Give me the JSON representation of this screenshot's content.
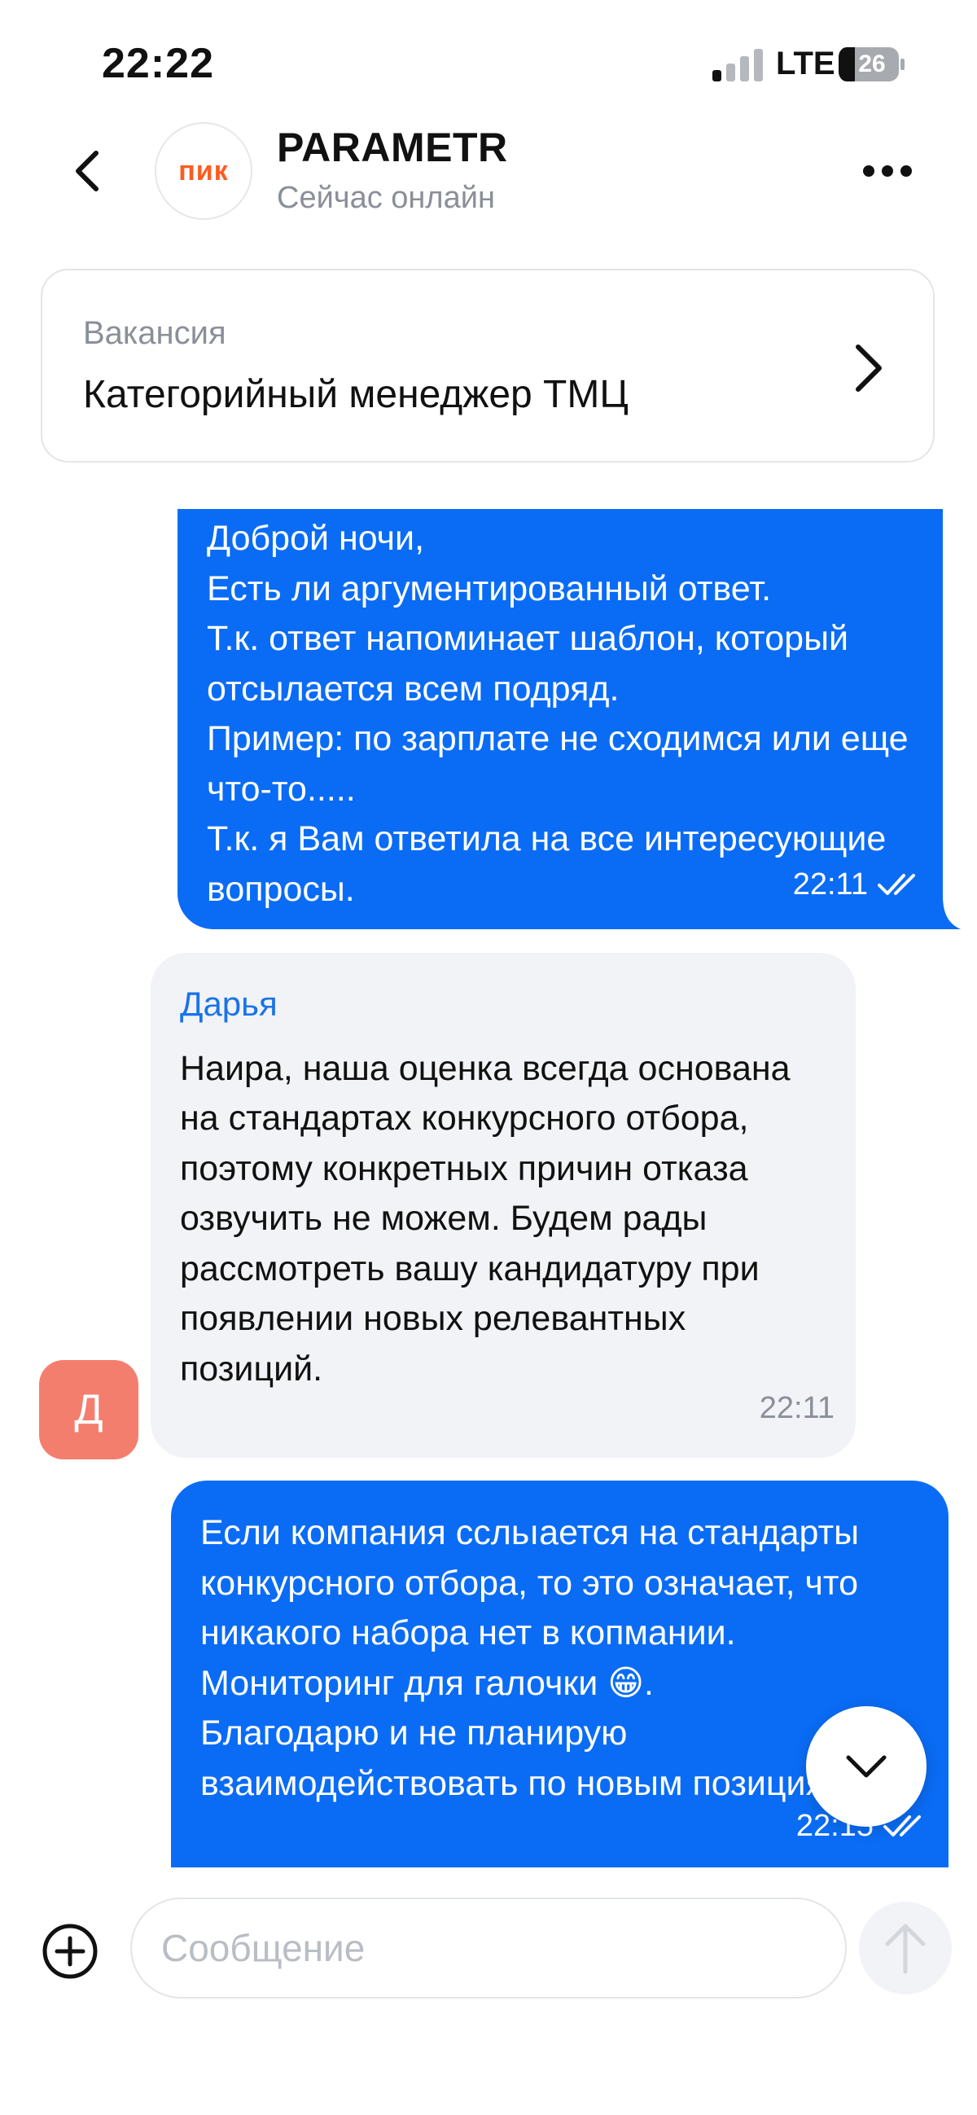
{
  "status_bar": {
    "time": "22:22",
    "network": "LTE",
    "battery": "26"
  },
  "header": {
    "logo_text": "пик",
    "title": "PARAMETR",
    "status": "Сейчас онлайн"
  },
  "vacancy": {
    "label": "Вакансия",
    "title": "Категорийный менеджер ТМЦ"
  },
  "messages": [
    {
      "direction": "outgoing",
      "text": "Доброй ночи,\nЕсть ли аргументированный ответ.\nТ.к. ответ напоминает шаблон, который отсылается всем подряд.\nПример: по зарплате не сходимся или еще что-то.....\nТ.к. я Вам ответила на все интересующие вопросы.",
      "time": "22:11",
      "read": true
    },
    {
      "direction": "incoming",
      "sender": "Дарья",
      "avatar_letter": "Д",
      "text": "Наира, наша оценка всегда основана на стандартах конкурсного отбора, поэтому конкретных причин отказа озвучить не можем. Будем рады рассмотреть вашу кандидатуру при появлении новых релевантных позиций.",
      "time": "22:11"
    },
    {
      "direction": "outgoing",
      "text": "Если компания ссльıается на стандарты конкурсного отбора, то это означает, что никакого набора нет в копмании. Мониторинг для галочки 😁.\nБлагодарю и не планирую взаимодействовать по новым позициям.",
      "time": "22:15",
      "read": true
    }
  ],
  "composer": {
    "placeholder": "Сообщение"
  },
  "colors": {
    "outgoing_bubble": "#0a6cf5",
    "incoming_bubble": "#f2f3f7",
    "sender_name": "#1a73e8",
    "avatar": "#f47e6e",
    "logo": "#ff5b1f"
  },
  "icons": [
    "back-icon",
    "more-icon",
    "chevron-right-icon",
    "double-check-icon",
    "chevron-down-icon",
    "plus-circle-icon",
    "arrow-up-icon"
  ]
}
